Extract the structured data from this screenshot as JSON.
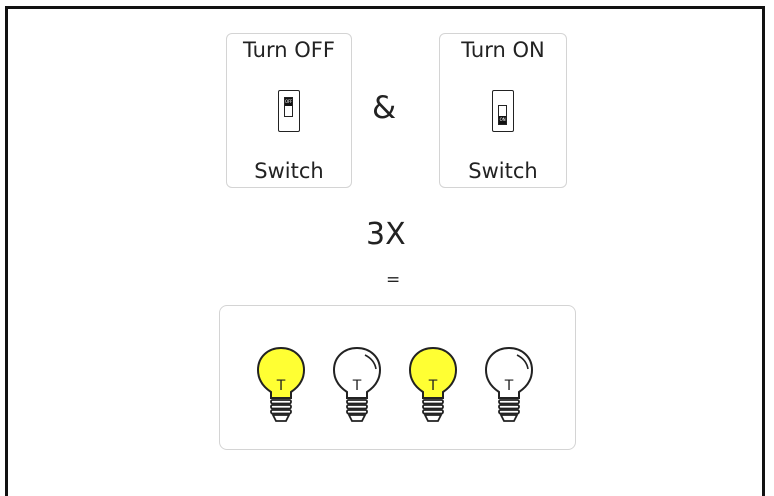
{
  "off_card": {
    "title": "Turn OFF",
    "switch_label": "OFF",
    "caption": "Switch"
  },
  "on_card": {
    "title": "Turn ON",
    "switch_label": "ON",
    "caption": "Switch"
  },
  "operator": "&",
  "multiplier": "3X",
  "equals": "=",
  "bulbs": [
    {
      "state": "on",
      "letter": "T",
      "color": "#ffff33"
    },
    {
      "state": "off",
      "letter": "T",
      "color": "#ffffff"
    },
    {
      "state": "on",
      "letter": "T",
      "color": "#ffff33"
    },
    {
      "state": "off",
      "letter": "T",
      "color": "#ffffff"
    }
  ]
}
